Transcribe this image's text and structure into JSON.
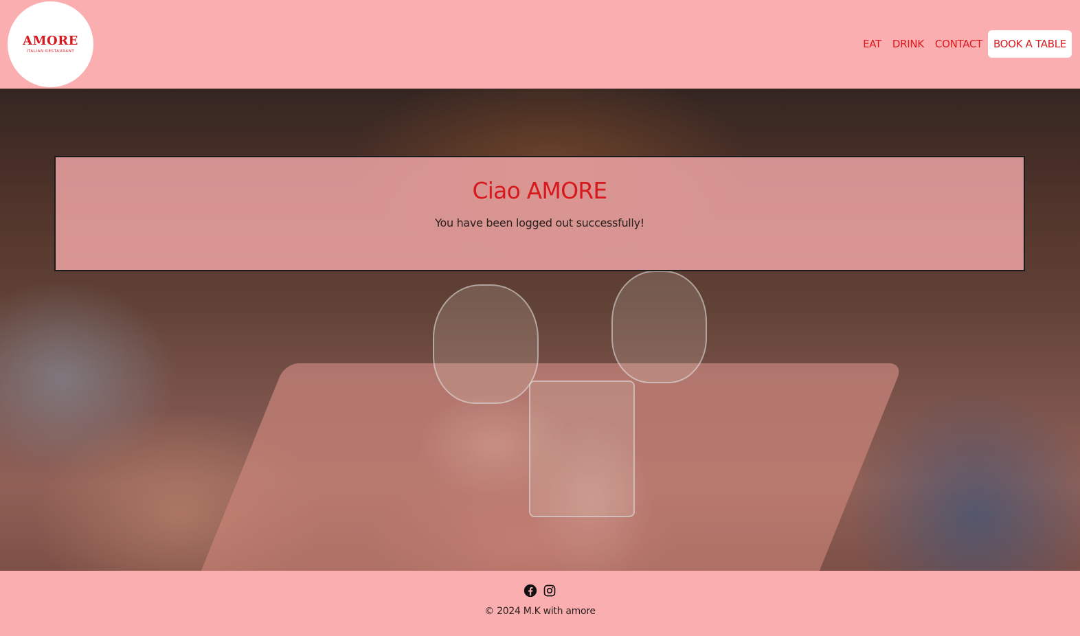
{
  "header": {
    "logo": {
      "wordmark": "AMORE",
      "tagline": "ITALIAN RESTAURANT"
    },
    "nav": [
      {
        "label": "EAT"
      },
      {
        "label": "DRINK"
      },
      {
        "label": "CONTACT"
      },
      {
        "label": "BOOK A TABLE"
      }
    ]
  },
  "main": {
    "title": "Ciao AMORE",
    "message": "You have been logged out successfully!"
  },
  "footer": {
    "social": [
      {
        "icon": "facebook-icon"
      },
      {
        "icon": "instagram-icon"
      }
    ],
    "copyright": "© 2024 M.K with amore"
  },
  "colors": {
    "brand_red": "#d7191e",
    "background_pink": "#fbaeb0",
    "text_dark": "#2b2220",
    "button_bg": "#ffffff"
  }
}
